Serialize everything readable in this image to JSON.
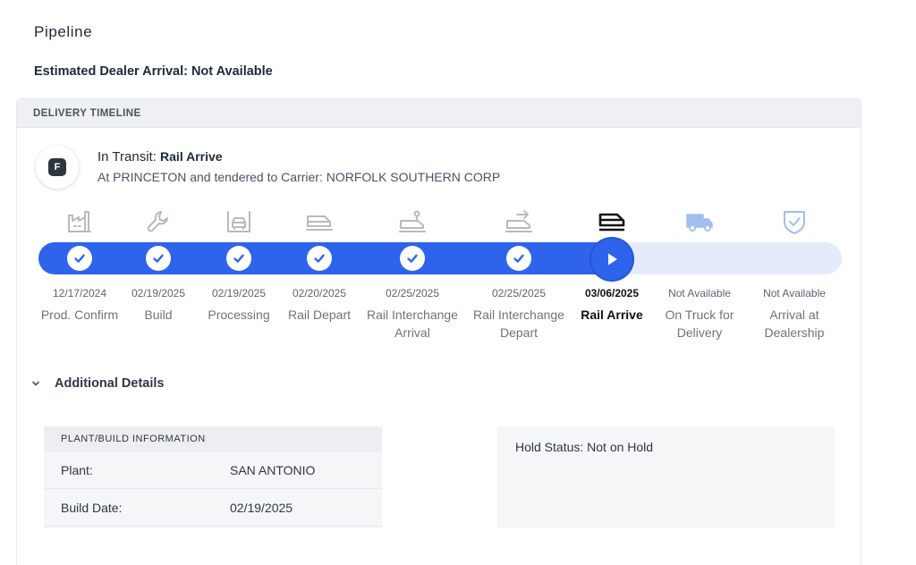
{
  "page": {
    "title": "Pipeline",
    "arrival_text": "Estimated Dealer Arrival: Not Available"
  },
  "timeline": {
    "header": "DELIVERY TIMELINE",
    "avatar_letter": "F",
    "status_prefix": "In Transit:",
    "status_value": "Rail Arrive",
    "status_detail": "At PRINCETON and tendered to Carrier: NORFOLK SOUTHERN CORP",
    "progress_fraction": 0.72,
    "stages": [
      {
        "date": "12/17/2024",
        "label": "Prod. Confirm",
        "state": "done",
        "icon": "factory-icon"
      },
      {
        "date": "02/19/2025",
        "label": "Build",
        "state": "done",
        "icon": "wrench-icon"
      },
      {
        "date": "02/19/2025",
        "label": "Processing",
        "state": "done",
        "icon": "car-processing-icon"
      },
      {
        "date": "02/20/2025",
        "label": "Rail Depart",
        "state": "done",
        "icon": "train-icon"
      },
      {
        "date": "02/25/2025",
        "label": "Rail Interchange Arrival",
        "state": "done",
        "icon": "train-interchange-arrival-icon"
      },
      {
        "date": "02/25/2025",
        "label": "Rail Interchange Depart",
        "state": "done",
        "icon": "train-interchange-depart-icon"
      },
      {
        "date": "03/06/2025",
        "label": "Rail Arrive",
        "state": "current",
        "icon": "train-arrive-icon"
      },
      {
        "date": "Not Available",
        "label": "On Truck for Delivery",
        "state": "pending",
        "icon": "truck-icon"
      },
      {
        "date": "Not Available",
        "label": "Arrival at Dealership",
        "state": "pending",
        "icon": "shield-check-icon"
      }
    ]
  },
  "details": {
    "toggle_label": "Additional Details",
    "plant_header": "PLANT/BUILD INFORMATION",
    "plant_label": "Plant:",
    "plant_value": "SAN ANTONIO",
    "build_date_label": "Build Date:",
    "build_date_value": "02/19/2025",
    "hold_status": "Hold Status: Not on Hold"
  },
  "colors": {
    "accent": "#2e64eb",
    "track_bg": "#e4ebfb",
    "icon_done": "#b6bac1",
    "icon_current": "#111111",
    "icon_pending": "#9fc0ee"
  }
}
